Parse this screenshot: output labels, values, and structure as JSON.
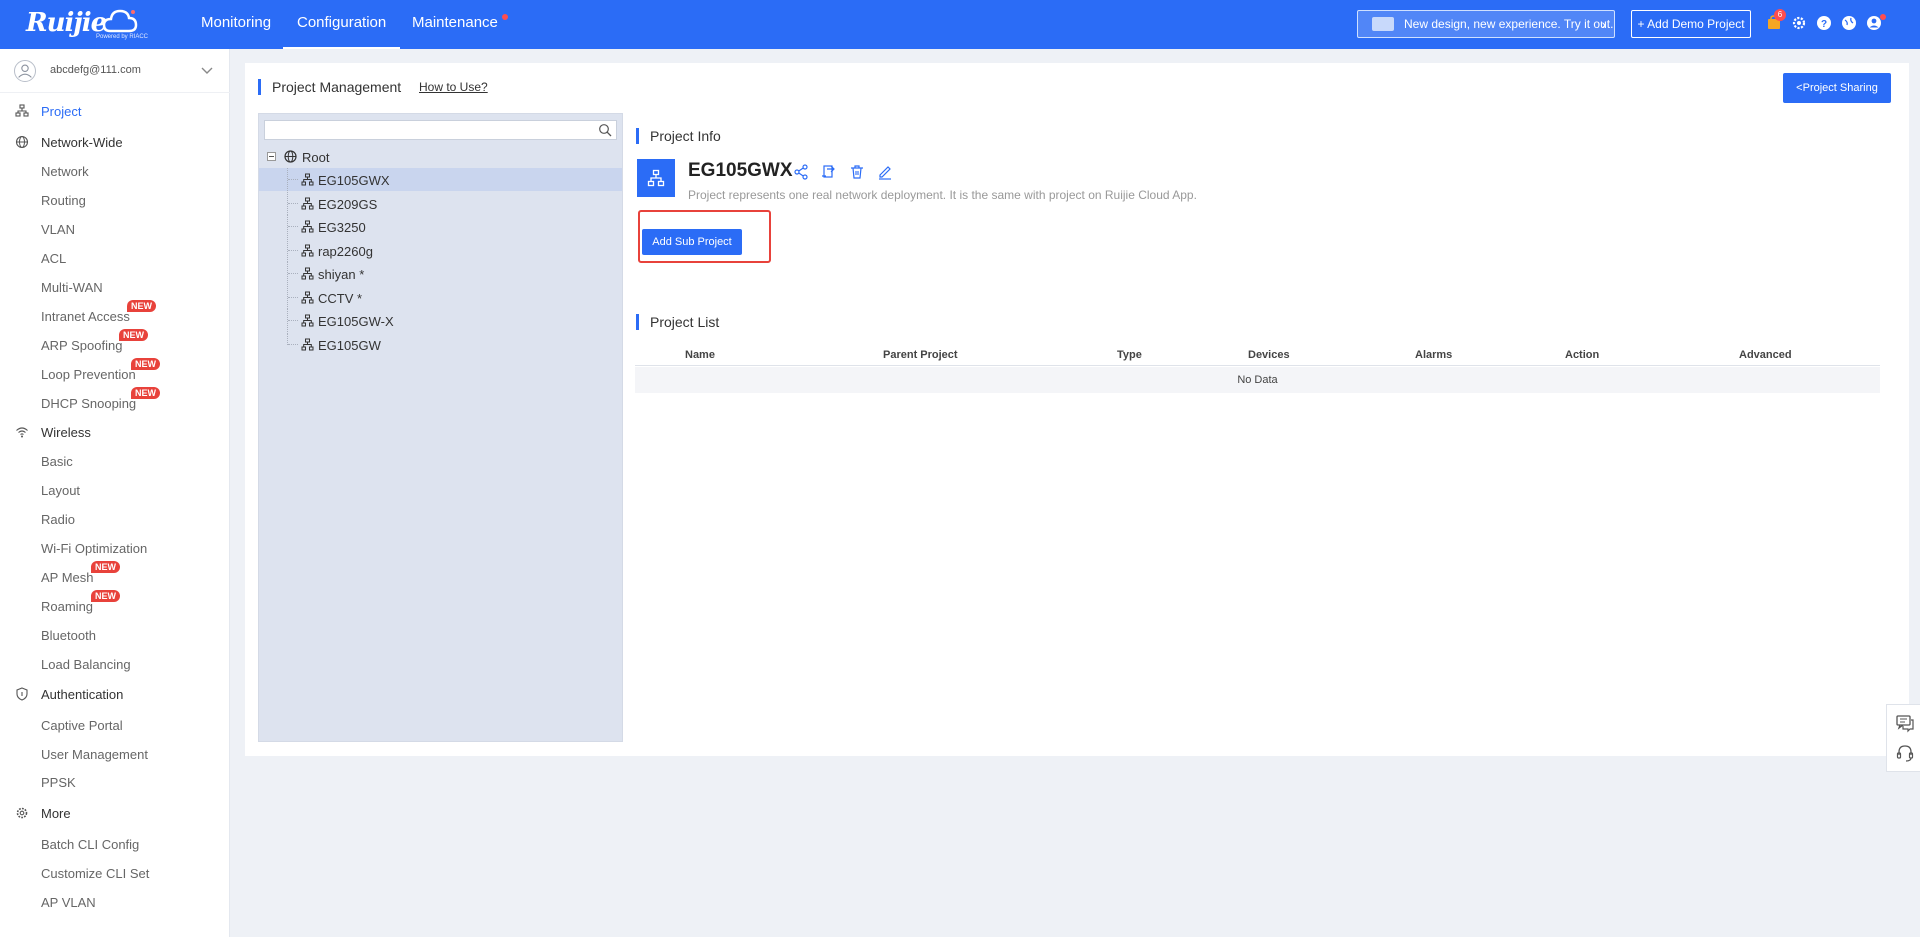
{
  "brand": {
    "logo_text": "Ruijie",
    "powered_by": "Powered by RIACC"
  },
  "topnav": {
    "items": [
      {
        "label": "Monitoring"
      },
      {
        "label": "Configuration"
      },
      {
        "label": "Maintenance"
      }
    ],
    "banner_label": "New design, new experience. Try it out.",
    "demo_label": "+ Add Demo Project",
    "notification_count": "6"
  },
  "account": {
    "email": "abcdefg@111.com"
  },
  "sidebar": {
    "project": "Project",
    "network_wide": "Network-Wide",
    "network": "Network",
    "routing": "Routing",
    "vlan": "VLAN",
    "acl": "ACL",
    "multiwan": "Multi-WAN",
    "intranet": "Intranet Access",
    "arp": "ARP Spoofing",
    "loop": "Loop Prevention",
    "dhcp": "DHCP Snooping",
    "wireless": "Wireless",
    "basic": "Basic",
    "layout": "Layout",
    "radio": "Radio",
    "wifiopt": "Wi-Fi Optimization",
    "apmesh": "AP Mesh",
    "roaming": "Roaming",
    "bluetooth": "Bluetooth",
    "loadbal": "Load Balancing",
    "auth": "Authentication",
    "captive": "Captive Portal",
    "usermgmt": "User Management",
    "ppsk": "PPSK",
    "more": "More",
    "batchcli": "Batch CLI Config",
    "customcli": "Customize CLI Set",
    "apvlan": "AP VLAN",
    "new_tag": "NEW"
  },
  "page": {
    "title": "Project Management",
    "how_to": "How to Use?",
    "share_label": "Project Sharing"
  },
  "tree": {
    "search_placeholder": "",
    "root": "Root",
    "items": [
      "EG105GWX",
      "EG209GS",
      "EG3250",
      "rap2260g",
      "shiyan *",
      "CCTV *",
      "EG105GW-X",
      "EG105GW"
    ]
  },
  "project_info": {
    "section_title": "Project Info",
    "name": "EG105GWX",
    "description": "Project represents one real network deployment. It is the same with project on Ruijie Cloud App.",
    "add_sub_label": "Add Sub Project"
  },
  "project_list": {
    "section_title": "Project List",
    "columns": [
      "Name",
      "Parent Project",
      "Type",
      "Devices",
      "Alarms",
      "Action",
      "Advanced"
    ],
    "empty_text": "No Data"
  },
  "colors": {
    "accent": "#2b6cf6",
    "highlight": "#e8423b",
    "new_tag": "#e8423b"
  }
}
